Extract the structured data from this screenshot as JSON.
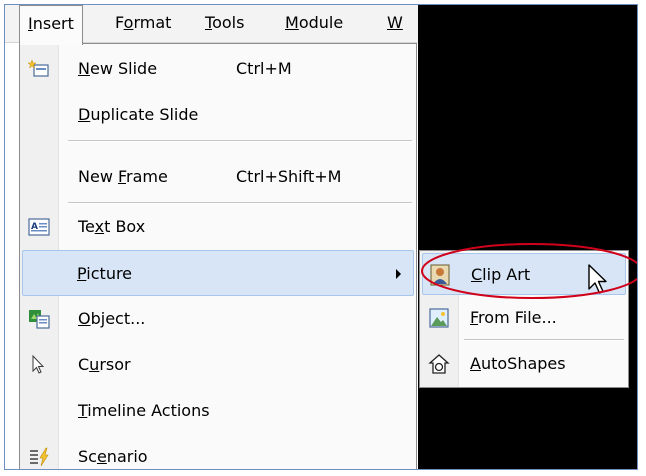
{
  "menubar": {
    "items": [
      {
        "pre": "",
        "acc": "I",
        "post": "nsert"
      },
      {
        "pre": "F",
        "acc": "o",
        "post": "rmat"
      },
      {
        "pre": "",
        "acc": "T",
        "post": "ools"
      },
      {
        "pre": "",
        "acc": "M",
        "post": "odule"
      },
      {
        "pre": "",
        "acc": "W",
        "post": ""
      }
    ]
  },
  "insert_menu": {
    "new_slide": {
      "pre": "",
      "acc": "N",
      "post": "ew Slide",
      "shortcut": "Ctrl+M",
      "icon": "new-slide-icon"
    },
    "duplicate_slide": {
      "pre": "",
      "acc": "D",
      "post": "uplicate Slide"
    },
    "new_frame": {
      "pre": "New ",
      "acc": "F",
      "post": "rame",
      "shortcut": "Ctrl+Shift+M"
    },
    "text_box": {
      "pre": "Te",
      "acc": "x",
      "post": "t Box",
      "icon": "text-box-icon"
    },
    "picture": {
      "pre": "",
      "acc": "P",
      "post": "icture"
    },
    "object": {
      "pre": "",
      "acc": "O",
      "post": "bject...",
      "icon": "object-icon"
    },
    "cursor": {
      "pre": "C",
      "acc": "u",
      "post": "rsor",
      "icon": "cursor-arrow-icon"
    },
    "timeline_actions": {
      "pre": "",
      "acc": "T",
      "post": "imeline Actions"
    },
    "scenario": {
      "pre": "Sc",
      "acc": "e",
      "post": "nario",
      "icon": "scenario-icon"
    }
  },
  "picture_submenu": {
    "clip_art": {
      "pre": "",
      "acc": "C",
      "post": "lip Art",
      "icon": "clip-art-icon"
    },
    "from_file": {
      "pre": "",
      "acc": "F",
      "post": "rom File...",
      "icon": "picture-file-icon"
    },
    "autoshapes": {
      "pre": "",
      "acc": "A",
      "post": "utoShapes",
      "icon": "autoshapes-icon"
    }
  },
  "colors": {
    "highlight": "#d7e5f7",
    "highlight_border": "#a8c6ec",
    "annotation": "#d0021b",
    "frame_border": "#6f8fc2"
  }
}
